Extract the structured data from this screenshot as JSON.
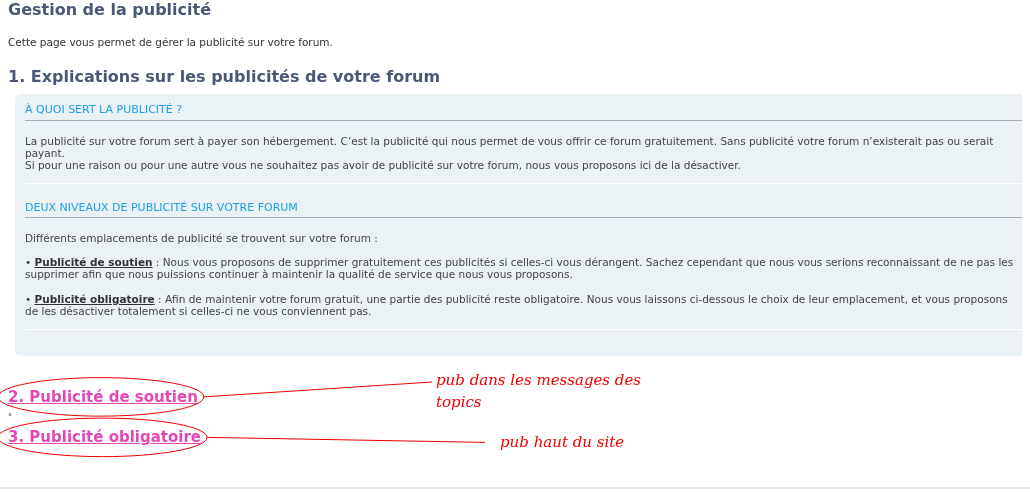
{
  "title": "Gestion de la publicité",
  "intro": "Cette page vous permet de gérer la publicité sur votre forum.",
  "section_1": {
    "heading": "1. Explications sur les publicités de votre forum",
    "panel": [
      {
        "heading": "À QUOI SERT LA PUBLICITÉ ?",
        "paragraphs": [
          {
            "kind": "plain",
            "text": "La publicité sur votre forum sert à payer son hébergement. C’est la publicité qui nous permet de vous offrir ce forum gratuitement. Sans publicité votre forum n’existerait pas ou serait payant.\nSi pour une raison ou pour une autre vous ne souhaitez pas avoir de publicité sur votre forum, nous vous proposons ici de la désactiver."
          }
        ]
      },
      {
        "heading": "DEUX NIVEAUX DE PUBLICITÉ SUR VOTRE FORUM",
        "paragraphs": [
          {
            "kind": "plain",
            "text": "Différents emplacements de publicité se trouvent sur votre forum :"
          },
          {
            "kind": "bullet",
            "bullet": "•",
            "term": "Publicité de soutien",
            "text": " : Nous vous proposons de supprimer gratuitement ces publicités si celles-ci vous dérangent. Sachez cependant que nous vous serions reconnaissant de ne pas les supprimer afin que nous puissions continuer à maintenir la qualité de service que nous vous proposons."
          },
          {
            "kind": "bullet",
            "bullet": "•",
            "term": "Publicité obligatoire",
            "text": " : Afin de maintenir votre forum gratuit, une partie des publicité reste obligatoire. Nous vous laissons ci-dessous le choix de leur emplacement, et vous proposons de les désactiver totalement si celles-ci ne vous conviennent pas."
          }
        ]
      }
    ]
  },
  "links": [
    {
      "text": "2. Publicité de soutien",
      "annotation": "pub dans les messages des topics"
    },
    {
      "text": "3. Publicité obligatoire",
      "annotation": "pub haut du site"
    }
  ],
  "stray_mark": "°"
}
